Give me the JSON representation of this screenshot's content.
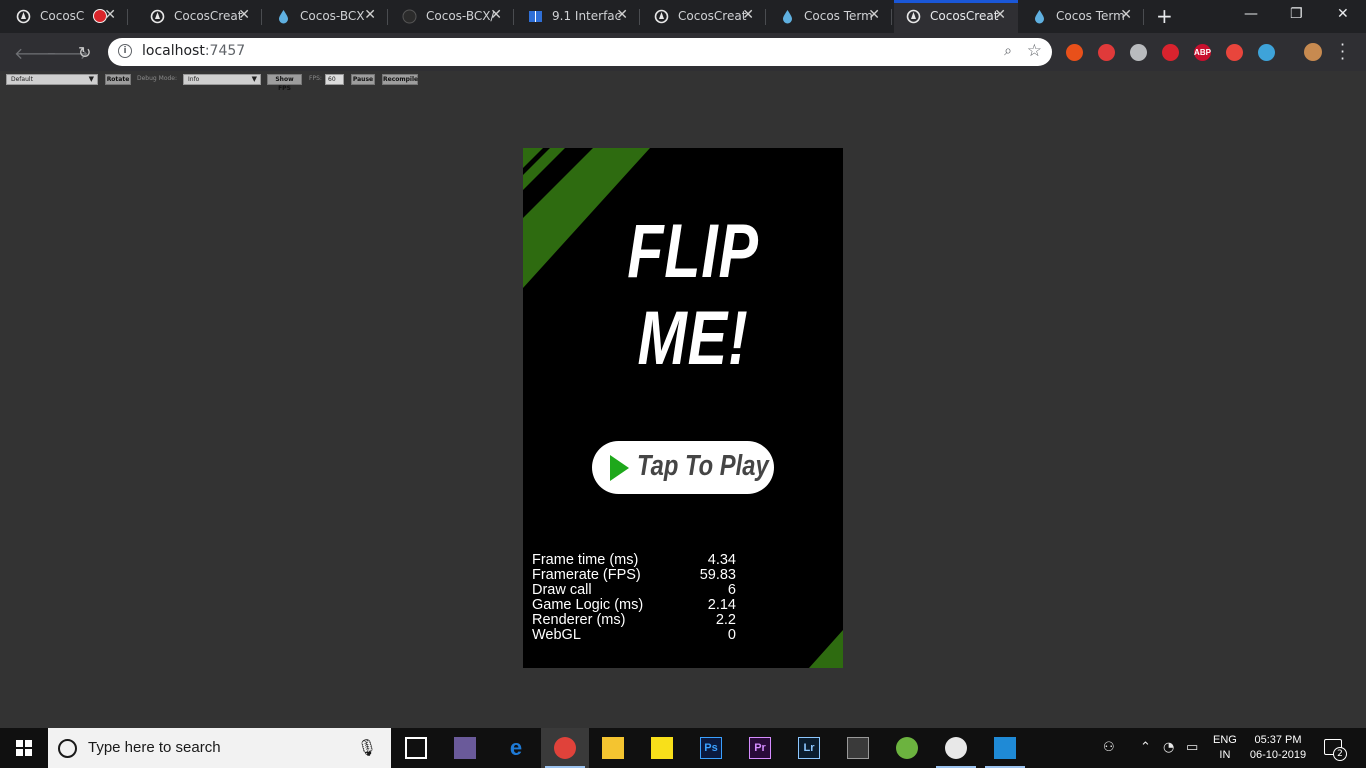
{
  "browser": {
    "tabs": [
      {
        "title": "CocosC",
        "icon": "cocos-creator-icon",
        "recording": true,
        "active": false
      },
      {
        "title": "CocosCreat",
        "icon": "cocos-creator-icon",
        "active": false
      },
      {
        "title": "Cocos-BCX",
        "icon": "cocos-bcx-drop-icon",
        "active": false
      },
      {
        "title": "Cocos-BCX/",
        "icon": "github-icon",
        "active": false
      },
      {
        "title": "9.1 Interfac",
        "icon": "book-icon",
        "active": false
      },
      {
        "title": "CocosCreat",
        "icon": "cocos-creator-icon",
        "active": false
      },
      {
        "title": "Cocos Term",
        "icon": "cocos-bcx-drop-icon",
        "active": false
      },
      {
        "title": "CocosCreat",
        "icon": "cocos-creator-icon",
        "active": true
      },
      {
        "title": "Cocos Term",
        "icon": "cocos-bcx-drop-icon",
        "active": false
      }
    ],
    "close_glyph": "✕",
    "new_tab_glyph": "+",
    "address": {
      "host": "localhost",
      "port": ":7457"
    },
    "extensions": [
      {
        "name": "fire-extension-icon",
        "color": "#e8501a",
        "label": ""
      },
      {
        "name": "arrow-extension-icon",
        "color": "#e03a3a",
        "label": ""
      },
      {
        "name": "discord-extension-icon",
        "color": "#b9bbbe",
        "label": ""
      },
      {
        "name": "hand-stop-extension-icon",
        "color": "#d9232e",
        "label": ""
      },
      {
        "name": "adblock-plus-icon",
        "color": "#c8102e",
        "label": "ABP"
      },
      {
        "name": "screen-record-extension-icon",
        "color": "#e8453c",
        "label": ""
      },
      {
        "name": "drop-extension-icon",
        "color": "#3ea3d9",
        "label": ""
      }
    ]
  },
  "simulator": {
    "device_select": "Default",
    "rotate_label": "Rotate",
    "debug_mode_label": "Debug Mode:",
    "debug_mode_value": "Info",
    "show_fps_label": "Show FPS",
    "fps_label": "FPS:",
    "fps_value": "60",
    "pause_label": "Pause",
    "recompile_label": "Recompile"
  },
  "game": {
    "title": "FLIP ME!",
    "play_label": "Tap To Play",
    "accent_color": "#2e6b10",
    "stats": [
      {
        "label": "Frame time (ms)",
        "value": "4.34"
      },
      {
        "label": "Framerate (FPS)",
        "value": "59.83"
      },
      {
        "label": "Draw call",
        "value": "6"
      },
      {
        "label": "Game Logic (ms)",
        "value": "2.14"
      },
      {
        "label": "Renderer (ms)",
        "value": "2.2"
      },
      {
        "label": "WebGL",
        "value": "0"
      }
    ]
  },
  "taskbar": {
    "search_placeholder": "Type here to search",
    "apps": [
      {
        "name": "task-view-icon",
        "label": "",
        "running": false
      },
      {
        "name": "file-manager-tool-icon",
        "label": "",
        "running": false
      },
      {
        "name": "edge-icon",
        "label": "e",
        "running": false
      },
      {
        "name": "chrome-icon",
        "label": "",
        "running": true,
        "active": true
      },
      {
        "name": "file-explorer-icon",
        "label": "",
        "running": false
      },
      {
        "name": "sticky-notes-icon",
        "label": "",
        "running": false
      },
      {
        "name": "photoshop-icon",
        "label": "Ps",
        "running": false
      },
      {
        "name": "premiere-pro-icon",
        "label": "Pr",
        "running": false
      },
      {
        "name": "lightroom-icon",
        "label": "Lr",
        "running": false
      },
      {
        "name": "terminal-icon",
        "label": "",
        "running": false
      },
      {
        "name": "utorrent-icon",
        "label": "",
        "running": false
      },
      {
        "name": "cocos-bcx-app-icon",
        "label": "",
        "running": true
      },
      {
        "name": "vscode-icon",
        "label": "",
        "running": true
      }
    ],
    "lang_top": "ENG",
    "lang_bottom": "IN",
    "time": "05:37 PM",
    "date": "06-10-2019",
    "notification_count": "2"
  }
}
